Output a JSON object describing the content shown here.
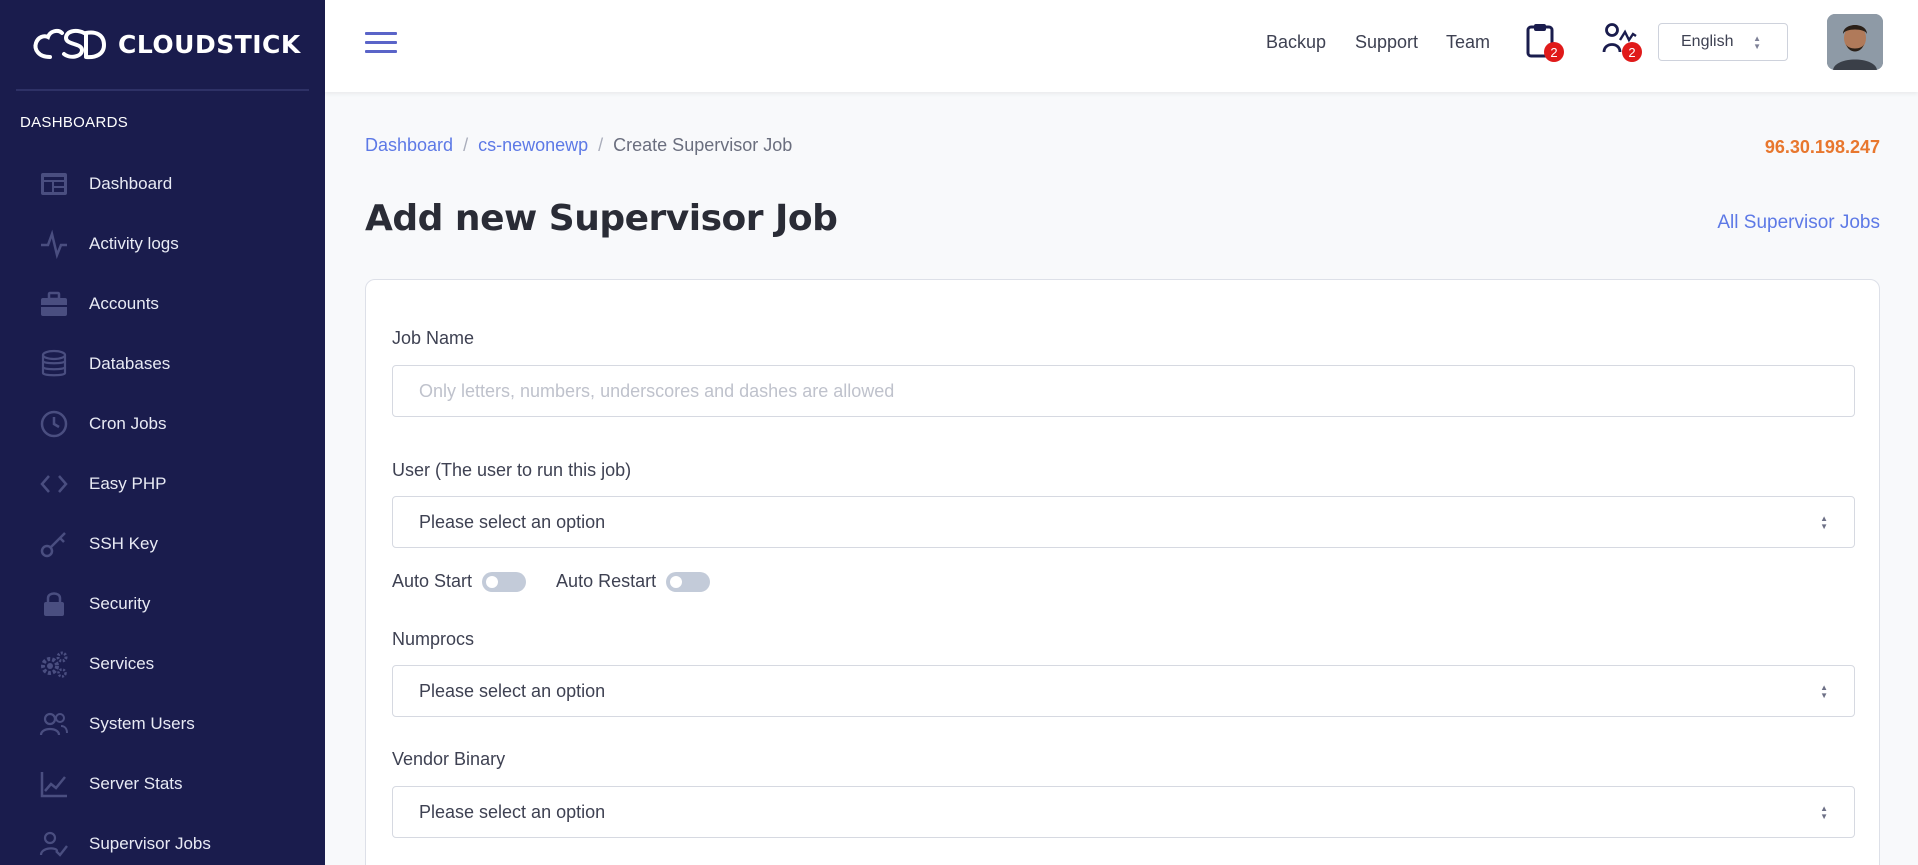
{
  "app": {
    "brand": "CLOUDSTICK"
  },
  "sidebar": {
    "section_title": "DASHBOARDS",
    "items": [
      {
        "label": "Dashboard",
        "icon": "dashboard-grid-icon"
      },
      {
        "label": "Activity logs",
        "icon": "activity-pulse-icon"
      },
      {
        "label": "Accounts",
        "icon": "briefcase-icon"
      },
      {
        "label": "Databases",
        "icon": "database-icon"
      },
      {
        "label": "Cron Jobs",
        "icon": "clock-icon"
      },
      {
        "label": "Easy PHP",
        "icon": "code-brackets-icon"
      },
      {
        "label": "SSH Key",
        "icon": "key-icon"
      },
      {
        "label": "Security",
        "icon": "lock-icon"
      },
      {
        "label": "Services",
        "icon": "gears-icon"
      },
      {
        "label": "System Users",
        "icon": "users-icon"
      },
      {
        "label": "Server Stats",
        "icon": "chart-line-icon"
      },
      {
        "label": "Supervisor Jobs",
        "icon": "user-check-icon"
      }
    ]
  },
  "header": {
    "links": {
      "backup": "Backup",
      "support": "Support",
      "team": "Team"
    },
    "tasks_badge": "2",
    "team_badge": "2",
    "language": "English"
  },
  "breadcrumb": {
    "home": "Dashboard",
    "server": "cs-newonewp",
    "current": "Create Supervisor Job"
  },
  "server_ip": "96.30.198.247",
  "page_title": "Add new Supervisor Job",
  "all_jobs_link": "All Supervisor Jobs",
  "form": {
    "job_name_label": "Job Name",
    "job_name_placeholder": "Only letters, numbers, underscores and dashes are allowed",
    "user_label": "User (The user to run this job)",
    "user_value": "Please select an option",
    "auto_start_label": "Auto Start",
    "auto_restart_label": "Auto Restart",
    "numprocs_label": "Numprocs",
    "numprocs_value": "Please select an option",
    "vendor_binary_label": "Vendor Binary",
    "vendor_binary_value": "Please select an option"
  },
  "colors": {
    "sidebar_bg": "#1a1c4d",
    "accent_link": "#5d79e6",
    "ip_orange": "#e8772e",
    "badge_red": "#e01a1a"
  }
}
